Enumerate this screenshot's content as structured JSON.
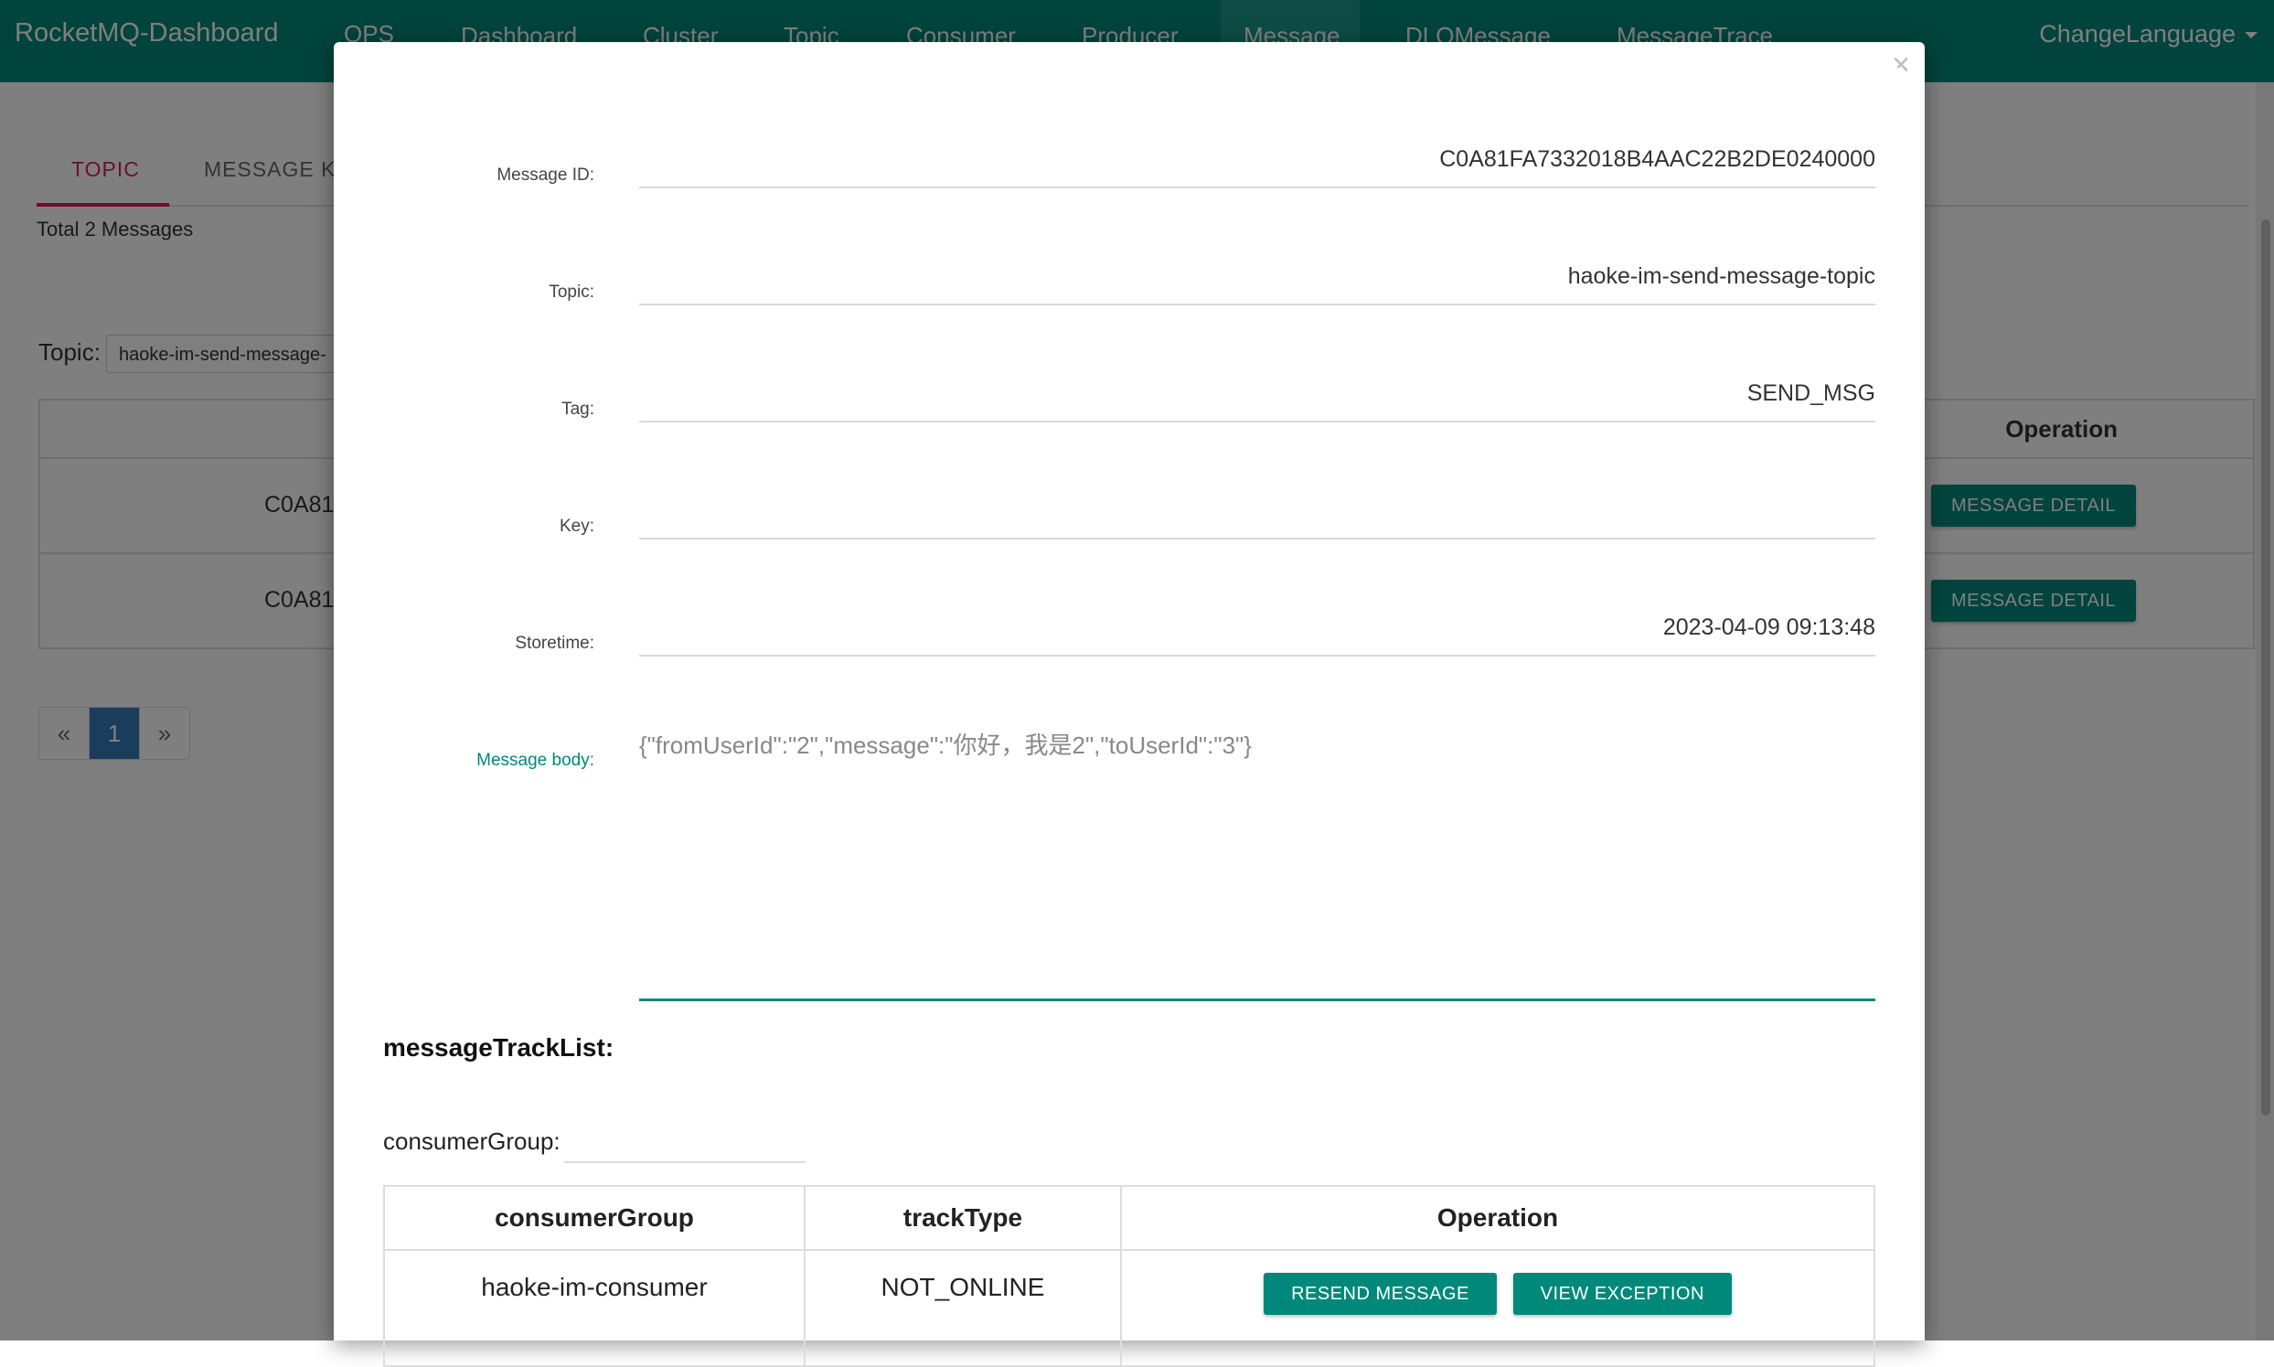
{
  "navbar": {
    "brand": "RocketMQ-Dashboard",
    "items": [
      "OPS",
      "Dashboard",
      "Cluster",
      "Topic",
      "Consumer",
      "Producer",
      "Message",
      "DLQMessage",
      "MessageTrace"
    ],
    "active": "Message",
    "language": "ChangeLanguage"
  },
  "page": {
    "tabs": [
      "TOPIC",
      "MESSAGE KE"
    ],
    "total": "Total 2 Messages",
    "topic_label": "Topic:",
    "topic_value": "haoke-im-send-message-",
    "table": {
      "operation_header": "Operation",
      "rows": [
        {
          "id": "C0A81",
          "button": "MESSAGE DETAIL"
        },
        {
          "id": "C0A81",
          "button": "MESSAGE DETAIL"
        }
      ]
    },
    "pager": {
      "prev": "«",
      "current": "1",
      "next": "»"
    }
  },
  "modal": {
    "close": "×",
    "fields": {
      "message_id": {
        "label": "Message ID:",
        "value": "C0A81FA7332018B4AAC22B2DE0240000"
      },
      "topic": {
        "label": "Topic:",
        "value": "haoke-im-send-message-topic"
      },
      "tag": {
        "label": "Tag:",
        "value": "SEND_MSG"
      },
      "key": {
        "label": "Key:",
        "value": ""
      },
      "storetime": {
        "label": "Storetime:",
        "value": "2023-04-09 09:13:48"
      },
      "body": {
        "label": "Message body:",
        "value": "{\"fromUserId\":\"2\",\"message\":\"你好，我是2\",\"toUserId\":\"3\"}"
      }
    },
    "track": {
      "title": "messageTrackList:",
      "consumer_group_label": "consumerGroup:",
      "consumer_group_value": "",
      "headers": [
        "consumerGroup",
        "trackType",
        "Operation"
      ],
      "rows": [
        {
          "consumerGroup": "haoke-im-consumer",
          "trackType": "NOT_ONLINE",
          "resend": "RESEND MESSAGE",
          "view": "VIEW EXCEPTION"
        }
      ]
    }
  },
  "colors": {
    "primary": "#00897b",
    "tab_active": "#d81b60",
    "pager_active": "#337ab7"
  }
}
